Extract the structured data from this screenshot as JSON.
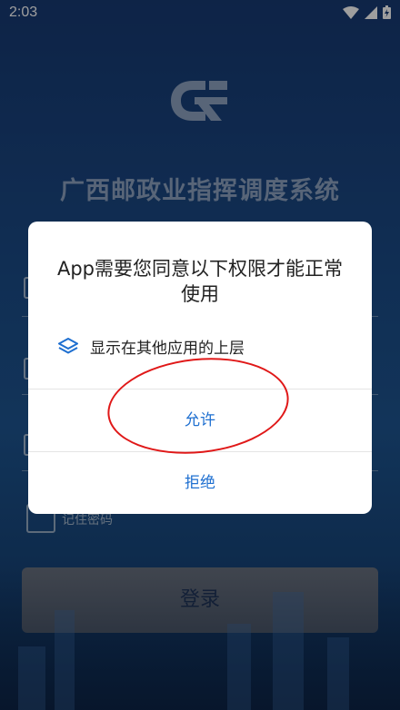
{
  "status_bar": {
    "time": "2:03"
  },
  "app": {
    "title": "广西邮政业指挥调度系统",
    "remember_label": "记住密码",
    "login_label": "登录"
  },
  "dialog": {
    "title": "App需要您同意以下权限才能正常使用",
    "permission": "显示在其他应用的上层",
    "allow_label": "允许",
    "deny_label": "拒绝"
  },
  "colors": {
    "accent": "#1e6fd0",
    "annotation": "#e01818"
  }
}
